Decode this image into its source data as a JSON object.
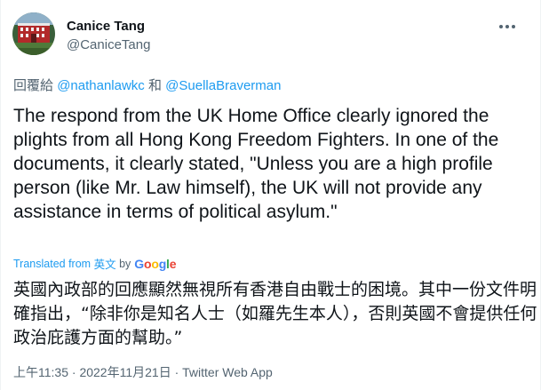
{
  "author": {
    "display_name": "Canice Tang",
    "handle": "@CaniceTang"
  },
  "reply": {
    "prefix": "回覆給",
    "mention_1": "@nathanlawkc",
    "conjunction": "和",
    "mention_2": "@SuellaBraverman"
  },
  "tweet": {
    "text": "The respond from the UK Home Office clearly ignored the plights from all Hong Kong Freedom Fighters.  In one of the documents, it clearly stated, \"Unless you are a high profile person (like Mr. Law himself), the UK will not provide any assistance in terms of political asylum.\"",
    "translated_label": "Translated from",
    "translated_lang": "英文",
    "translated_by": "by",
    "translation": "英國內政部的回應顯然無視所有香港自由戰士的困境。其中一份文件明確指出，“除非你是知名人士（如羅先生本人），否則英國不會提供任何政治庇護方面的幫助。”"
  },
  "google_logo": {
    "g1": "G",
    "o1": "o",
    "o2": "o",
    "g2": "g",
    "l": "l",
    "e": "e"
  },
  "meta": {
    "time": "上午11:35",
    "date": "2022年11月21日",
    "separator": "·",
    "source": "Twitter Web App"
  },
  "icons": {
    "more": "more-horizontal-icon",
    "avatar": "avatar-image"
  },
  "colors": {
    "link": "#1d9bf0",
    "secondary": "#536471",
    "text": "#0f1419"
  }
}
